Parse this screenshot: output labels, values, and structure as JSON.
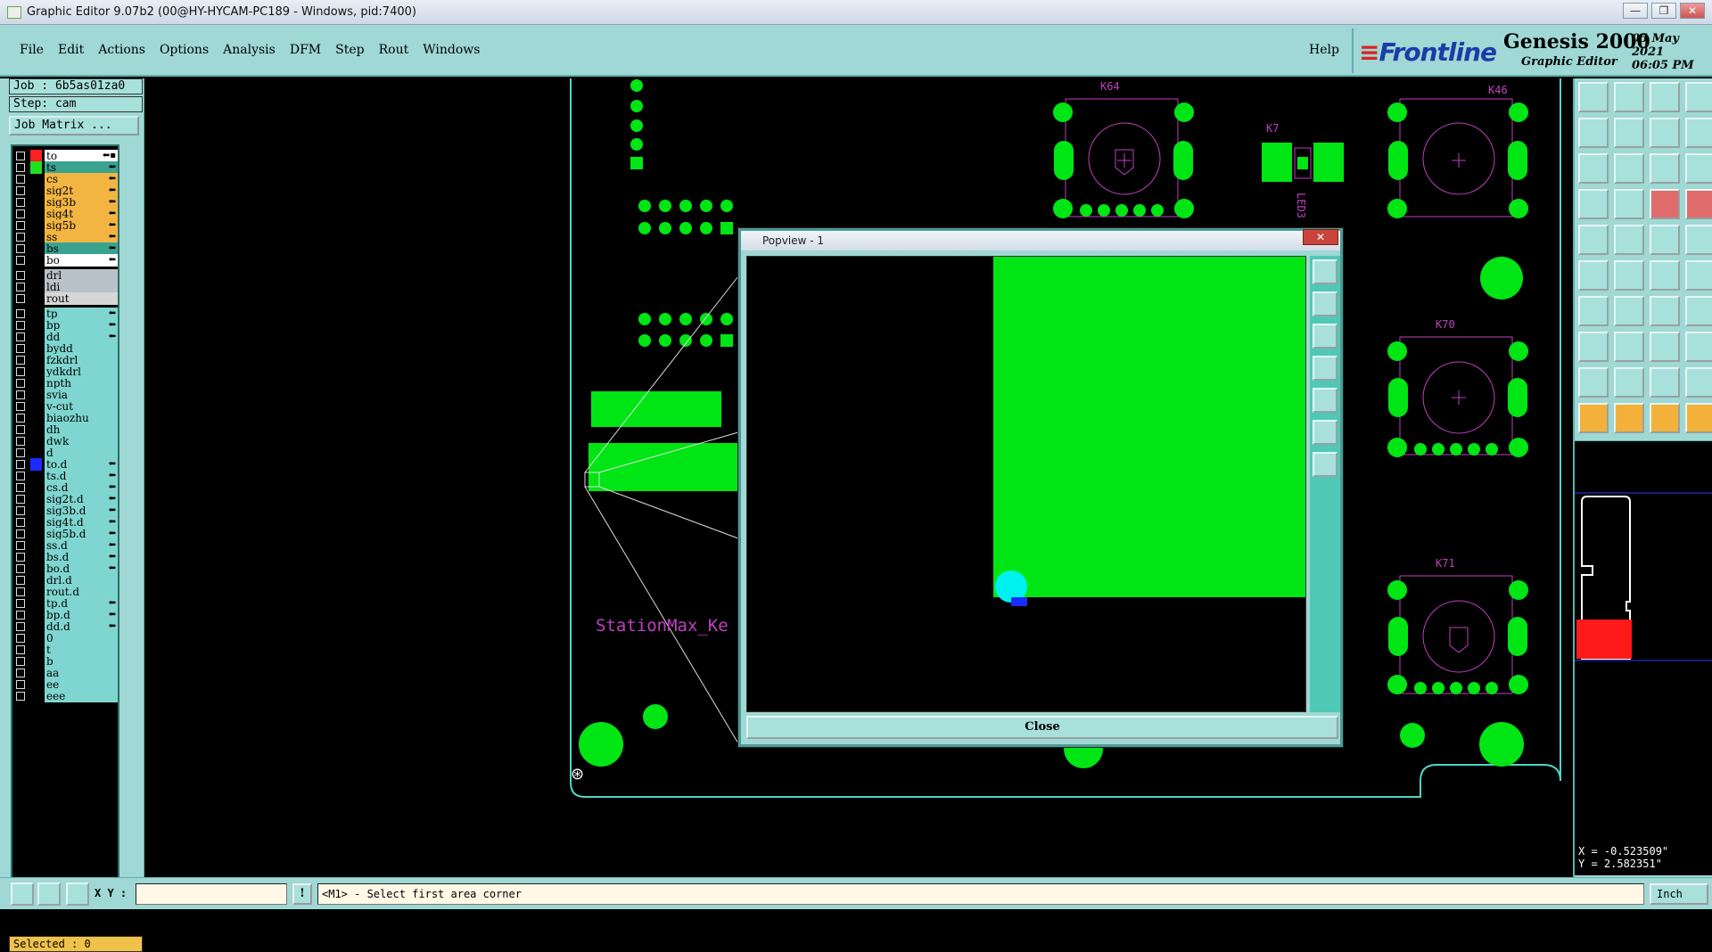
{
  "window": {
    "title": "Graphic Editor 9.07b2 (00@HY-HYCAM-PC189 - Windows, pid:7400)",
    "controls": [
      "—",
      "❐",
      "✕"
    ]
  },
  "menu": {
    "items": [
      "File",
      "Edit",
      "Actions",
      "Options",
      "Analysis",
      "DFM",
      "Step",
      "Rout",
      "Windows"
    ],
    "help": "Help"
  },
  "brand": {
    "logo": "Frontline",
    "product": "Genesis 2000",
    "subtitle": "Graphic Editor",
    "date": "05 May 2021",
    "time": "06:05 PM"
  },
  "job": {
    "job_line": "Job : 6b5as01za0",
    "step_line": "Step: cam",
    "matrix_button": "Job Matrix ..."
  },
  "layers": [
    {
      "name": "to",
      "color": "#ffffff",
      "swatch": "#ff2020",
      "flag": "⬅▪"
    },
    {
      "name": "ts",
      "color": "#3aa38f",
      "swatch": "#20e020",
      "flag": "⬅"
    },
    {
      "name": "cs",
      "color": "#f2b541",
      "swatch": "",
      "flag": "⬅"
    },
    {
      "name": "sig2t",
      "color": "#f2b541",
      "swatch": "",
      "flag": "⬅"
    },
    {
      "name": "sig3b",
      "color": "#f2b541",
      "swatch": "",
      "flag": "⬅"
    },
    {
      "name": "sig4t",
      "color": "#f2b541",
      "swatch": "",
      "flag": "⬅"
    },
    {
      "name": "sig5b",
      "color": "#f2b541",
      "swatch": "",
      "flag": "⬅"
    },
    {
      "name": "ss",
      "color": "#f2b541",
      "swatch": "",
      "flag": "⬅"
    },
    {
      "name": "bs",
      "color": "#3aa38f",
      "swatch": "",
      "flag": "⬅"
    },
    {
      "name": "bo",
      "color": "#ffffff",
      "swatch": "",
      "flag": "⬅"
    },
    {
      "name": "drl",
      "color": "#b8c2c8",
      "swatch": "",
      "flag": ""
    },
    {
      "name": "ldi",
      "color": "#b8c2c8",
      "swatch": "",
      "flag": ""
    },
    {
      "name": "rout",
      "color": "#d6d6d6",
      "swatch": "",
      "flag": ""
    },
    {
      "name": "tp",
      "color": "#7fd6d0",
      "swatch": "",
      "flag": "⬅"
    },
    {
      "name": "bp",
      "color": "#7fd6d0",
      "swatch": "",
      "flag": "⬅"
    },
    {
      "name": "dd",
      "color": "#7fd6d0",
      "swatch": "",
      "flag": "⬅"
    },
    {
      "name": "bydd",
      "color": "#7fd6d0",
      "swatch": "",
      "flag": ""
    },
    {
      "name": "fzkdrl",
      "color": "#7fd6d0",
      "swatch": "",
      "flag": ""
    },
    {
      "name": "ydkdrl",
      "color": "#7fd6d0",
      "swatch": "",
      "flag": ""
    },
    {
      "name": "npth",
      "color": "#7fd6d0",
      "swatch": "",
      "flag": ""
    },
    {
      "name": "svia",
      "color": "#7fd6d0",
      "swatch": "",
      "flag": ""
    },
    {
      "name": "v-cut",
      "color": "#7fd6d0",
      "swatch": "",
      "flag": ""
    },
    {
      "name": "biaozhu",
      "color": "#7fd6d0",
      "swatch": "",
      "flag": ""
    },
    {
      "name": "dh",
      "color": "#7fd6d0",
      "swatch": "",
      "flag": ""
    },
    {
      "name": "dwk",
      "color": "#7fd6d0",
      "swatch": "",
      "flag": ""
    },
    {
      "name": "d",
      "color": "#7fd6d0",
      "swatch": "",
      "flag": ""
    },
    {
      "name": "to.d",
      "color": "#7fd6d0",
      "swatch": "#1a2cff",
      "flag": "⬅"
    },
    {
      "name": "ts.d",
      "color": "#7fd6d0",
      "swatch": "",
      "flag": "⬅"
    },
    {
      "name": "cs.d",
      "color": "#7fd6d0",
      "swatch": "",
      "flag": "⬅"
    },
    {
      "name": "sig2t.d",
      "color": "#7fd6d0",
      "swatch": "",
      "flag": "⬅"
    },
    {
      "name": "sig3b.d",
      "color": "#7fd6d0",
      "swatch": "",
      "flag": "⬅"
    },
    {
      "name": "sig4t.d",
      "color": "#7fd6d0",
      "swatch": "",
      "flag": "⬅"
    },
    {
      "name": "sig5b.d",
      "color": "#7fd6d0",
      "swatch": "",
      "flag": "⬅"
    },
    {
      "name": "ss.d",
      "color": "#7fd6d0",
      "swatch": "",
      "flag": "⬅"
    },
    {
      "name": "bs.d",
      "color": "#7fd6d0",
      "swatch": "",
      "flag": "⬅"
    },
    {
      "name": "bo.d",
      "color": "#7fd6d0",
      "swatch": "",
      "flag": "⬅"
    },
    {
      "name": "drl.d",
      "color": "#7fd6d0",
      "swatch": "",
      "flag": ""
    },
    {
      "name": "rout.d",
      "color": "#7fd6d0",
      "swatch": "",
      "flag": ""
    },
    {
      "name": "tp.d",
      "color": "#7fd6d0",
      "swatch": "",
      "flag": "⬅"
    },
    {
      "name": "bp.d",
      "color": "#7fd6d0",
      "swatch": "",
      "flag": "⬅"
    },
    {
      "name": "dd.d",
      "color": "#7fd6d0",
      "swatch": "",
      "flag": "⬅"
    },
    {
      "name": "0",
      "color": "#7fd6d0",
      "swatch": "",
      "flag": ""
    },
    {
      "name": "t",
      "color": "#7fd6d0",
      "swatch": "",
      "flag": ""
    },
    {
      "name": "b",
      "color": "#7fd6d0",
      "swatch": "",
      "flag": ""
    },
    {
      "name": "aa",
      "color": "#7fd6d0",
      "swatch": "",
      "flag": ""
    },
    {
      "name": "ee",
      "color": "#7fd6d0",
      "swatch": "",
      "flag": ""
    },
    {
      "name": "eee",
      "color": "#7fd6d0",
      "swatch": "",
      "flag": ""
    }
  ],
  "selected": "Selected : 0",
  "canvas": {
    "component_labels": [
      "K64",
      "K46",
      "K7",
      "K70",
      "K71",
      "LED3"
    ],
    "board_text": "StationMax_Ke"
  },
  "popview": {
    "title": "Popview - 1",
    "close_label": "Close",
    "close_x": "✕"
  },
  "status": {
    "xy_label": "X Y :",
    "xy_value": "",
    "prompt": "<M1> - Select first area corner",
    "unit": "Inch",
    "x_coord": "X = -0.523509\"",
    "y_coord": "Y = 2.582351\""
  },
  "colors": {
    "panel": "#9fd8d4",
    "copper": "#00e614",
    "outline": "#c040c0",
    "board_edge": "#4fd6c8"
  }
}
